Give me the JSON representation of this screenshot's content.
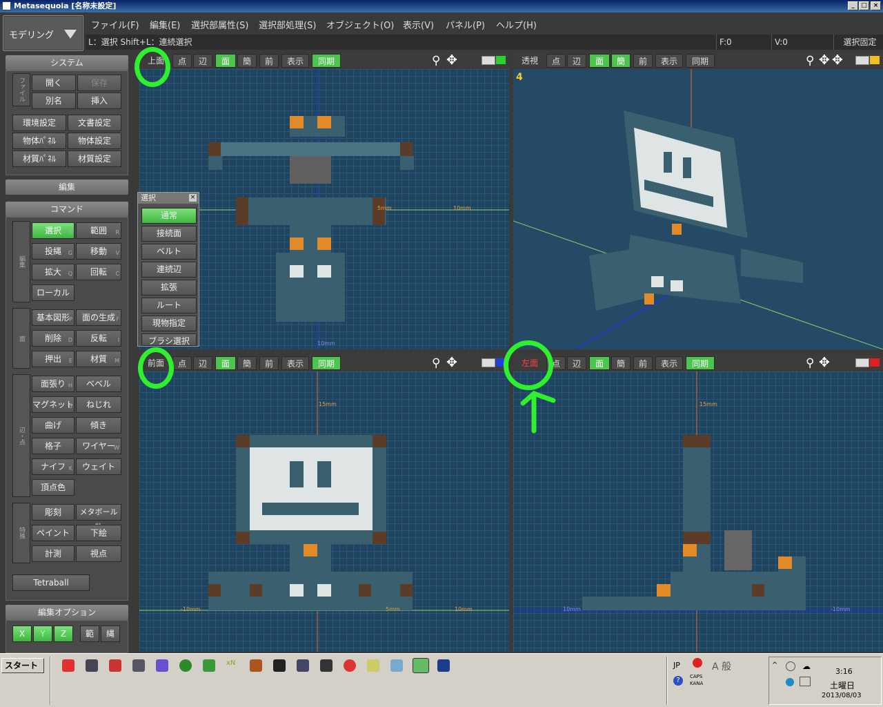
{
  "window": {
    "title": "Metasequoia [名称未設定]",
    "min": "_",
    "max": "□",
    "close": "×"
  },
  "mode": {
    "label": "モデリング"
  },
  "menu": [
    "ファイル(F)",
    "編集(E)",
    "選択部属性(S)",
    "選択部処理(S)",
    "オブジェクト(O)",
    "表示(V)",
    "パネル(P)",
    "ヘルプ(H)"
  ],
  "status": {
    "hint": "L：選択  Shift+L：連続選択",
    "faces": "F:0",
    "verts": "V:0",
    "fix": "選択固定"
  },
  "panel": {
    "system": "システム",
    "file_label": "ファイル",
    "open": "開く",
    "save": "保存",
    "saveas": "別名",
    "insert": "挿入",
    "env": "環境設定",
    "docset": "文書設定",
    "objpanel": "物体ﾊﾟﾈﾙ",
    "objset": "物体設定",
    "matpanel": "材質ﾊﾟﾈﾙ",
    "matset": "材質設定",
    "edit": "編集",
    "command": "コマンド",
    "g1": "編集",
    "select": "選択",
    "range": "範囲",
    "lasso": "投縄",
    "move": "移動",
    "scale": "拡大",
    "rotate": "回転",
    "local": "ローカル",
    "g2": "面",
    "prim": "基本図形",
    "genface": "面の生成",
    "delete": "削除",
    "flip": "反転",
    "extrude": "押出",
    "material": "材質",
    "g3": "辺・点",
    "facefill": "面張り",
    "bevel": "ベベル",
    "magnet": "マグネット",
    "twist": "ねじれ",
    "bend": "曲げ",
    "tilt": "傾き",
    "lattice": "格子",
    "wire": "ワイヤー",
    "knife": "ナイフ",
    "weight": "ウェイト",
    "vcolor": "頂点色",
    "g4": "特殊",
    "sculpt": "彫刻",
    "metaball": "メタボール粘",
    "paint": "ペイント",
    "underlay": "下絵",
    "measure": "計測",
    "view": "視点",
    "tetra": "Tetraball",
    "editopt": "編集オプション",
    "x": "X",
    "y": "Y",
    "z": "Z",
    "rng": "範",
    "rope": "縄"
  },
  "shortcuts": {
    "select": "S",
    "range": "R",
    "lasso": "G",
    "move": "V",
    "scale": "Q",
    "rotate": "C",
    "prim": "P",
    "genface": "F",
    "delete": "D",
    "flip": "I",
    "extrude": "E",
    "material": "M",
    "facefill": "H",
    "magnet": "B",
    "wire": "W",
    "knife": "K"
  },
  "viewports": [
    {
      "name": "上面",
      "tools": [
        "点",
        "辺",
        "面",
        "簡",
        "前",
        "表示",
        "同期"
      ]
    },
    {
      "name": "透視",
      "tools": [
        "点",
        "辺",
        "面",
        "簡",
        "前",
        "表示",
        "同期"
      ],
      "num": "4"
    },
    {
      "name": "前面",
      "tools": [
        "点",
        "辺",
        "面",
        "簡",
        "前",
        "表示",
        "同期"
      ]
    },
    {
      "name": "左面",
      "tools": [
        "点",
        "辺",
        "面",
        "簡",
        "前",
        "表示",
        "同期"
      ]
    }
  ],
  "rulers": {
    "r1": "5mm",
    "r2": "10mm",
    "r3": "10mm",
    "r4": "15mm",
    "r5": "-10mm",
    "r6": "5mm",
    "r7": "10mm",
    "r8": "15mm",
    "r9": "10mm",
    "r10": "-10mm"
  },
  "selpanel": {
    "title": "選択",
    "items": [
      "通常",
      "接続面",
      "ベルト",
      "連続辺",
      "拡張",
      "ルート",
      "現物指定",
      "ブラシ選択"
    ]
  },
  "taskbar": {
    "start": "スタート",
    "lang": "JP",
    "caps": "CAPS",
    "kana": "KANA",
    "time": "3:16",
    "day": "土曜日",
    "date": "2013/08/03",
    "ime": "A 般"
  }
}
